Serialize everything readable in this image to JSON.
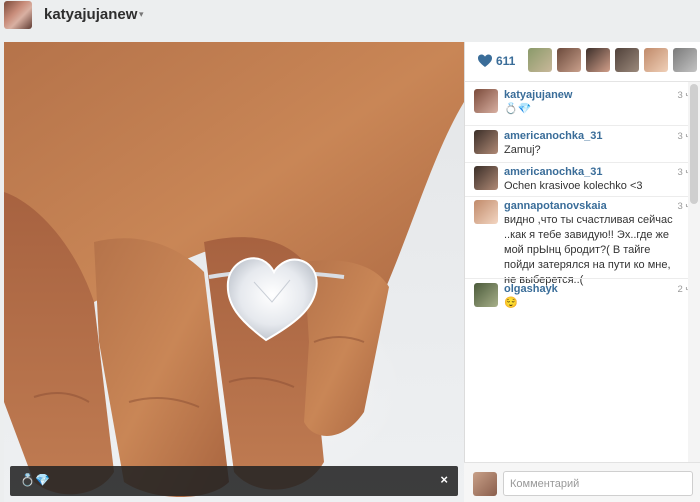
{
  "header": {
    "username": "katyajujanew",
    "caret": "▾"
  },
  "photo": {
    "caption": "💍💎",
    "close": "×"
  },
  "likes": {
    "count": "611"
  },
  "comments": [
    {
      "user": "katyajujanew",
      "text": "💍💎",
      "time": "3 ч."
    },
    {
      "user": "americanochka_31",
      "text": "Zamuj?",
      "time": "3 ч."
    },
    {
      "user": "americanochka_31",
      "text": "Ochen krasivoe kolechko <3",
      "time": "3 ч."
    },
    {
      "user": "gannapotanovskaia",
      "text": "видно ,что ты счастливая сейчас ..как я тебе завидую!! Эх..где же мой прЫнц бродит?( В тайге пойди затерялся на пути ко мне, не выберется..(",
      "time": "3 ч."
    },
    {
      "user": "olgashayk",
      "text": "😌",
      "time": "2 ч."
    }
  ],
  "composer": {
    "placeholder": "Комментарий"
  },
  "colors": {
    "link": "#3a6d99",
    "heart": "#3a6d99"
  }
}
